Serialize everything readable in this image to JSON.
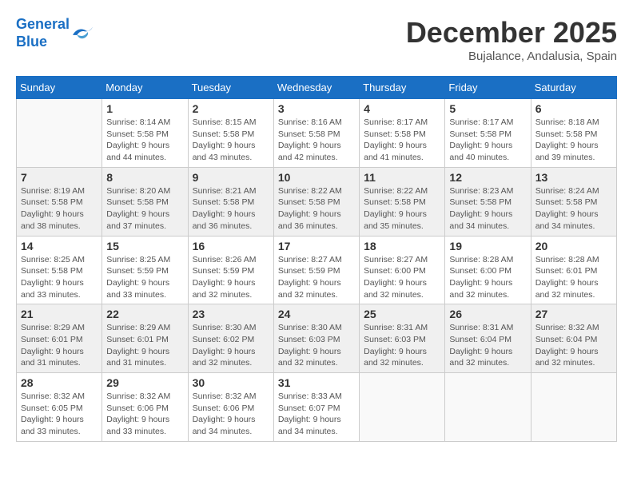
{
  "logo": {
    "line1": "General",
    "line2": "Blue"
  },
  "title": "December 2025",
  "subtitle": "Bujalance, Andalusia, Spain",
  "weekdays": [
    "Sunday",
    "Monday",
    "Tuesday",
    "Wednesday",
    "Thursday",
    "Friday",
    "Saturday"
  ],
  "weeks": [
    [
      {
        "day": "",
        "info": ""
      },
      {
        "day": "1",
        "info": "Sunrise: 8:14 AM\nSunset: 5:58 PM\nDaylight: 9 hours\nand 44 minutes."
      },
      {
        "day": "2",
        "info": "Sunrise: 8:15 AM\nSunset: 5:58 PM\nDaylight: 9 hours\nand 43 minutes."
      },
      {
        "day": "3",
        "info": "Sunrise: 8:16 AM\nSunset: 5:58 PM\nDaylight: 9 hours\nand 42 minutes."
      },
      {
        "day": "4",
        "info": "Sunrise: 8:17 AM\nSunset: 5:58 PM\nDaylight: 9 hours\nand 41 minutes."
      },
      {
        "day": "5",
        "info": "Sunrise: 8:17 AM\nSunset: 5:58 PM\nDaylight: 9 hours\nand 40 minutes."
      },
      {
        "day": "6",
        "info": "Sunrise: 8:18 AM\nSunset: 5:58 PM\nDaylight: 9 hours\nand 39 minutes."
      }
    ],
    [
      {
        "day": "7",
        "info": "Sunrise: 8:19 AM\nSunset: 5:58 PM\nDaylight: 9 hours\nand 38 minutes."
      },
      {
        "day": "8",
        "info": "Sunrise: 8:20 AM\nSunset: 5:58 PM\nDaylight: 9 hours\nand 37 minutes."
      },
      {
        "day": "9",
        "info": "Sunrise: 8:21 AM\nSunset: 5:58 PM\nDaylight: 9 hours\nand 36 minutes."
      },
      {
        "day": "10",
        "info": "Sunrise: 8:22 AM\nSunset: 5:58 PM\nDaylight: 9 hours\nand 36 minutes."
      },
      {
        "day": "11",
        "info": "Sunrise: 8:22 AM\nSunset: 5:58 PM\nDaylight: 9 hours\nand 35 minutes."
      },
      {
        "day": "12",
        "info": "Sunrise: 8:23 AM\nSunset: 5:58 PM\nDaylight: 9 hours\nand 34 minutes."
      },
      {
        "day": "13",
        "info": "Sunrise: 8:24 AM\nSunset: 5:58 PM\nDaylight: 9 hours\nand 34 minutes."
      }
    ],
    [
      {
        "day": "14",
        "info": "Sunrise: 8:25 AM\nSunset: 5:58 PM\nDaylight: 9 hours\nand 33 minutes."
      },
      {
        "day": "15",
        "info": "Sunrise: 8:25 AM\nSunset: 5:59 PM\nDaylight: 9 hours\nand 33 minutes."
      },
      {
        "day": "16",
        "info": "Sunrise: 8:26 AM\nSunset: 5:59 PM\nDaylight: 9 hours\nand 32 minutes."
      },
      {
        "day": "17",
        "info": "Sunrise: 8:27 AM\nSunset: 5:59 PM\nDaylight: 9 hours\nand 32 minutes."
      },
      {
        "day": "18",
        "info": "Sunrise: 8:27 AM\nSunset: 6:00 PM\nDaylight: 9 hours\nand 32 minutes."
      },
      {
        "day": "19",
        "info": "Sunrise: 8:28 AM\nSunset: 6:00 PM\nDaylight: 9 hours\nand 32 minutes."
      },
      {
        "day": "20",
        "info": "Sunrise: 8:28 AM\nSunset: 6:01 PM\nDaylight: 9 hours\nand 32 minutes."
      }
    ],
    [
      {
        "day": "21",
        "info": "Sunrise: 8:29 AM\nSunset: 6:01 PM\nDaylight: 9 hours\nand 31 minutes."
      },
      {
        "day": "22",
        "info": "Sunrise: 8:29 AM\nSunset: 6:01 PM\nDaylight: 9 hours\nand 31 minutes."
      },
      {
        "day": "23",
        "info": "Sunrise: 8:30 AM\nSunset: 6:02 PM\nDaylight: 9 hours\nand 32 minutes."
      },
      {
        "day": "24",
        "info": "Sunrise: 8:30 AM\nSunset: 6:03 PM\nDaylight: 9 hours\nand 32 minutes."
      },
      {
        "day": "25",
        "info": "Sunrise: 8:31 AM\nSunset: 6:03 PM\nDaylight: 9 hours\nand 32 minutes."
      },
      {
        "day": "26",
        "info": "Sunrise: 8:31 AM\nSunset: 6:04 PM\nDaylight: 9 hours\nand 32 minutes."
      },
      {
        "day": "27",
        "info": "Sunrise: 8:32 AM\nSunset: 6:04 PM\nDaylight: 9 hours\nand 32 minutes."
      }
    ],
    [
      {
        "day": "28",
        "info": "Sunrise: 8:32 AM\nSunset: 6:05 PM\nDaylight: 9 hours\nand 33 minutes."
      },
      {
        "day": "29",
        "info": "Sunrise: 8:32 AM\nSunset: 6:06 PM\nDaylight: 9 hours\nand 33 minutes."
      },
      {
        "day": "30",
        "info": "Sunrise: 8:32 AM\nSunset: 6:06 PM\nDaylight: 9 hours\nand 34 minutes."
      },
      {
        "day": "31",
        "info": "Sunrise: 8:33 AM\nSunset: 6:07 PM\nDaylight: 9 hours\nand 34 minutes."
      },
      {
        "day": "",
        "info": ""
      },
      {
        "day": "",
        "info": ""
      },
      {
        "day": "",
        "info": ""
      }
    ]
  ]
}
